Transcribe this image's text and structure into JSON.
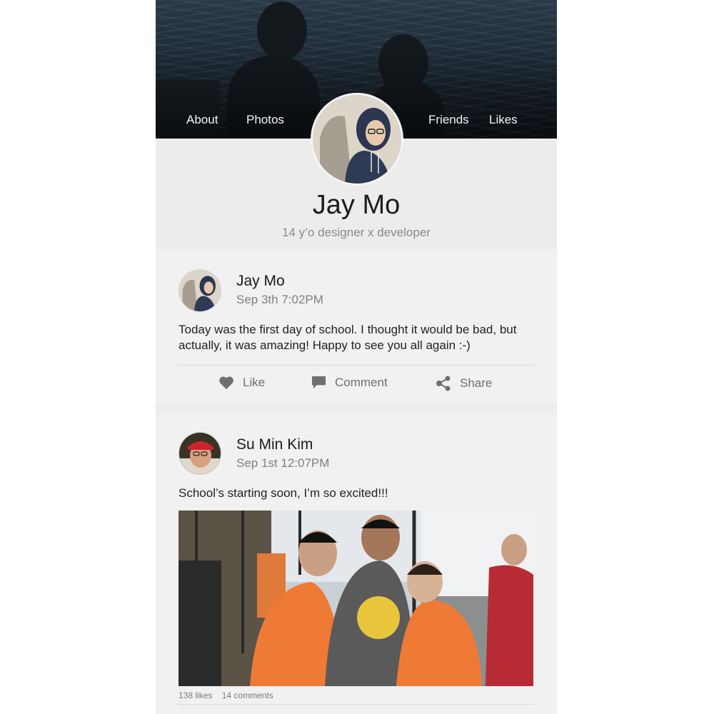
{
  "cover": {
    "nav_left": [
      "About",
      "Photos"
    ],
    "nav_right": [
      "Friends",
      "Likes"
    ]
  },
  "profile": {
    "name": "Jay Mo",
    "tagline": "14 y’o designer x developer"
  },
  "posts": [
    {
      "author": "Jay Mo",
      "date": "Sep 3th 7:02PM",
      "text": "Today was the first day of school. I thought it would be bad, but actually, it was amazing! Happy to see you all again :-)",
      "actions": [
        "Like",
        "Comment",
        "Share"
      ]
    },
    {
      "author": "Su Min Kim",
      "date": "Sep 1st 12:07PM",
      "text": "School’s starting soon, I’m so excited!!!",
      "likes": "138 likes",
      "comments": "14 comments"
    }
  ],
  "colors": {
    "background": "#ececed",
    "card": "#f1f1f2",
    "icon_gray": "#6f6f6f"
  }
}
